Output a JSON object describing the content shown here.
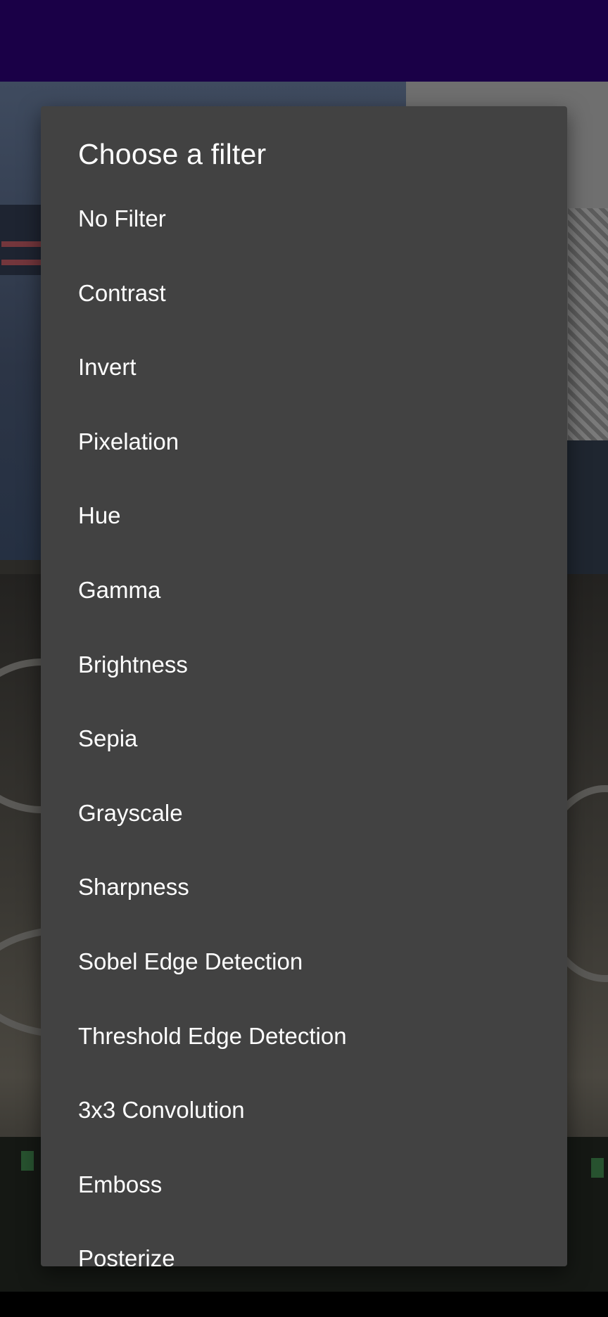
{
  "dialog": {
    "title": "Choose a filter",
    "items": [
      {
        "label": "No Filter"
      },
      {
        "label": "Contrast"
      },
      {
        "label": "Invert"
      },
      {
        "label": "Pixelation"
      },
      {
        "label": "Hue"
      },
      {
        "label": "Gamma"
      },
      {
        "label": "Brightness"
      },
      {
        "label": "Sepia"
      },
      {
        "label": "Grayscale"
      },
      {
        "label": "Sharpness"
      },
      {
        "label": "Sobel Edge Detection"
      },
      {
        "label": "Threshold Edge Detection"
      },
      {
        "label": "3x3 Convolution"
      },
      {
        "label": "Emboss"
      },
      {
        "label": "Posterize"
      }
    ]
  },
  "colors": {
    "app_bar": "#1a0047",
    "dialog_background": "#424242",
    "text": "#ffffff"
  }
}
